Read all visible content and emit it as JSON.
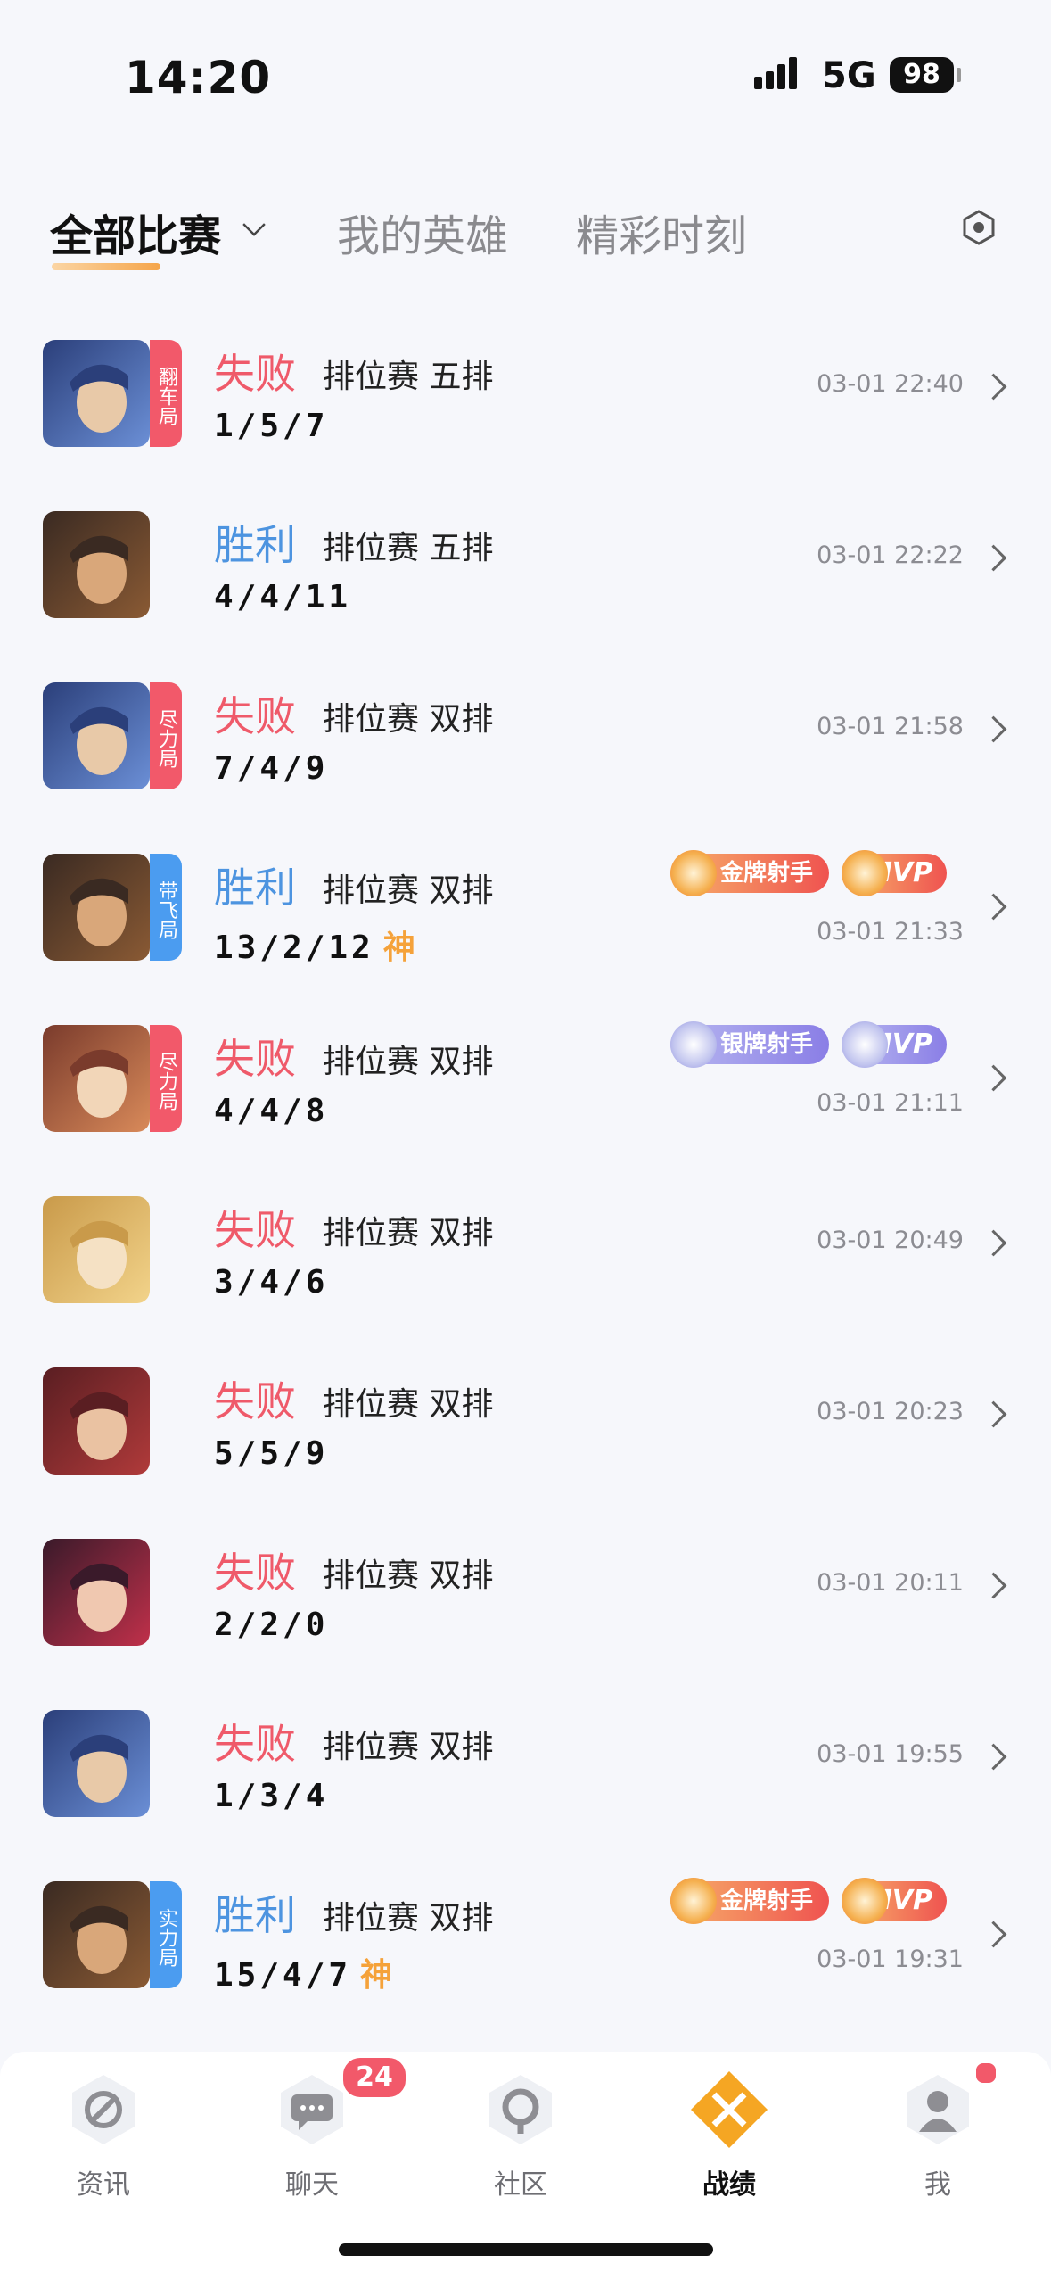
{
  "status_bar": {
    "time": "14:20",
    "network": "5G",
    "battery": "98"
  },
  "tabs": [
    {
      "label": "全部比赛",
      "active": true
    },
    {
      "label": "我的英雄",
      "active": false
    },
    {
      "label": "精彩时刻",
      "active": false
    }
  ],
  "matches": [
    {
      "result": "失败",
      "outcome": "lose",
      "mode": "排位赛 五排",
      "kda": "1/5/7",
      "time": "03-01 22:40",
      "tag": "翻车局",
      "tag_color": "red",
      "hero": "hero-a",
      "shen": "",
      "badges": []
    },
    {
      "result": "胜利",
      "outcome": "win",
      "mode": "排位赛 五排",
      "kda": "4/4/11",
      "time": "03-01 22:22",
      "tag": "",
      "tag_color": "",
      "hero": "hero-b",
      "shen": "",
      "badges": []
    },
    {
      "result": "失败",
      "outcome": "lose",
      "mode": "排位赛 双排",
      "kda": "7/4/9",
      "time": "03-01 21:58",
      "tag": "尽力局",
      "tag_color": "red",
      "hero": "hero-a",
      "shen": "",
      "badges": []
    },
    {
      "result": "胜利",
      "outcome": "win",
      "mode": "排位赛 双排",
      "kda": "13/2/12",
      "time": "03-01 21:33",
      "tag": "带飞局",
      "tag_color": "blue",
      "hero": "hero-b",
      "shen": "神",
      "badges": [
        {
          "label": "金牌射手",
          "kind": "gold"
        },
        {
          "label": "MVP",
          "kind": "gold-mvp"
        }
      ]
    },
    {
      "result": "失败",
      "outcome": "lose",
      "mode": "排位赛 双排",
      "kda": "4/4/8",
      "time": "03-01 21:11",
      "tag": "尽力局",
      "tag_color": "red",
      "hero": "hero-c",
      "shen": "",
      "badges": [
        {
          "label": "银牌射手",
          "kind": "silver"
        },
        {
          "label": "MVP",
          "kind": "silver-mvp"
        }
      ]
    },
    {
      "result": "失败",
      "outcome": "lose",
      "mode": "排位赛 双排",
      "kda": "3/4/6",
      "time": "03-01 20:49",
      "tag": "",
      "tag_color": "",
      "hero": "hero-d",
      "shen": "",
      "badges": []
    },
    {
      "result": "失败",
      "outcome": "lose",
      "mode": "排位赛 双排",
      "kda": "5/5/9",
      "time": "03-01 20:23",
      "tag": "",
      "tag_color": "",
      "hero": "hero-e",
      "shen": "",
      "badges": []
    },
    {
      "result": "失败",
      "outcome": "lose",
      "mode": "排位赛 双排",
      "kda": "2/2/0",
      "time": "03-01 20:11",
      "tag": "",
      "tag_color": "",
      "hero": "hero-f",
      "shen": "",
      "badges": []
    },
    {
      "result": "失败",
      "outcome": "lose",
      "mode": "排位赛 双排",
      "kda": "1/3/4",
      "time": "03-01 19:55",
      "tag": "",
      "tag_color": "",
      "hero": "hero-a",
      "shen": "",
      "badges": []
    },
    {
      "result": "胜利",
      "outcome": "win",
      "mode": "排位赛 双排",
      "kda": "15/4/7",
      "time": "03-01 19:31",
      "tag": "实力局",
      "tag_color": "blue",
      "hero": "hero-b",
      "shen": "神",
      "badges": [
        {
          "label": "金牌射手",
          "kind": "gold"
        },
        {
          "label": "MVP",
          "kind": "gold-mvp"
        }
      ]
    }
  ],
  "nav": [
    {
      "label": "资讯",
      "icon": "news-icon",
      "active": false
    },
    {
      "label": "聊天",
      "icon": "chat-icon",
      "active": false,
      "badge": "24"
    },
    {
      "label": "社区",
      "icon": "community-icon",
      "active": false
    },
    {
      "label": "战绩",
      "icon": "battle-record-icon",
      "active": true
    },
    {
      "label": "我",
      "icon": "profile-icon",
      "active": false,
      "dot": true
    }
  ],
  "colors": {
    "lose": "#ef5a6a",
    "win": "#4d94e0",
    "accent": "#f5a23a"
  }
}
